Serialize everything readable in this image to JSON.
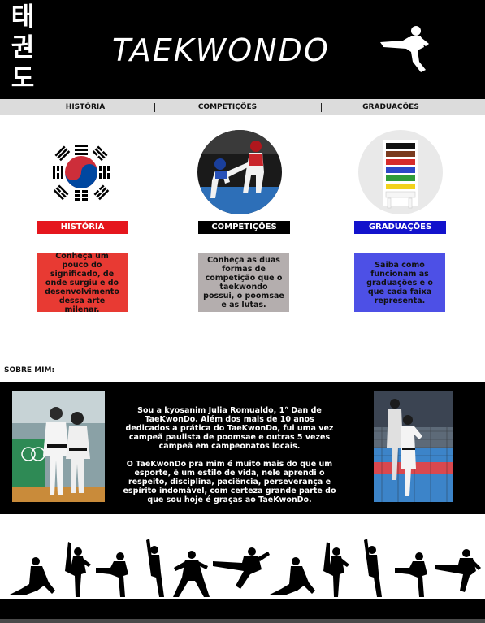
{
  "header": {
    "hangul": [
      "태",
      "권",
      "도"
    ],
    "title": "TAEKWONDO"
  },
  "nav": {
    "items": [
      "HISTÓRIA",
      "COMPETIÇÕES",
      "GRADUAÇÕES"
    ]
  },
  "cards": [
    {
      "label": "HISTÓRIA",
      "color": "#e5161d",
      "description": "Conheça um pouco do significado, de onde surgiu e do desenvolvimento dessa arte milenar.",
      "desc_color": "#e83a33"
    },
    {
      "label": "COMPETIÇÕES",
      "color": "#000000",
      "description": "Conheça as duas formas de competição que o taekwondo possui, o poomsae e as lutas.",
      "desc_color": "#b4aeae"
    },
    {
      "label": "GRADUAÇÕES",
      "color": "#1212cc",
      "description": "Saiba como funcionam as graduações e o que cada faixa representa.",
      "desc_color": "#4d50e6"
    }
  ],
  "about": {
    "title": "SOBRE MIM:",
    "paragraph1": "Sou a kyosanim Julia Romualdo, 1° Dan de TaeKwonDo. Além dos mais de 10 anos dedicados a prática do TaeKwonDo, fui uma vez campeã paulista de poomsae e outras 5 vezes campeã em campeonatos locais.",
    "paragraph2": "O TaeKwonDo pra mim é muito mais do que um esporte, é um estilo de vida, nele aprendi o respeito, disciplina, paciência, perseverança e espírito indomável, com certeza grande parte do que sou hoje é graças ao TaeKwonDo."
  },
  "icons": {
    "kicker": "taekwondo-kicker-icon",
    "flag": "korean-flag-icon",
    "competition": "competition-photo",
    "belts": "belt-rack-photo"
  },
  "colors": {
    "header_bg": "#000000",
    "nav_bg": "#dcdcdc"
  }
}
